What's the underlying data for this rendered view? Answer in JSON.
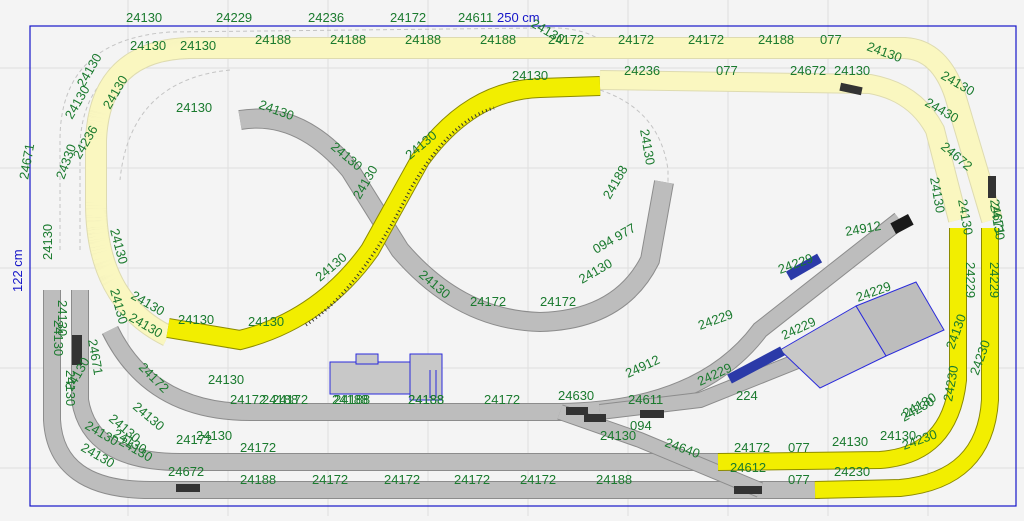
{
  "dimensions": {
    "width_label": "250 cm",
    "height_label": "122 cm"
  },
  "colors": {
    "background": "#f4f4f4",
    "grid": "#dedede",
    "track_grey": "#bdbdbd",
    "track_yellow": "#f2ee00",
    "track_pale_yellow": "#faf7c0",
    "label_green": "#1a7a2e",
    "dimension_blue": "#1515c8",
    "station_blue": "#9aa6d8"
  },
  "labels": [
    {
      "text": "24130"
    },
    {
      "text": "24229"
    },
    {
      "text": "24236"
    },
    {
      "text": "24172"
    },
    {
      "text": "24611"
    },
    {
      "text": "24130"
    },
    {
      "text": "24188"
    },
    {
      "text": "24188"
    },
    {
      "text": "24188"
    },
    {
      "text": "24188"
    },
    {
      "text": "24172"
    },
    {
      "text": "24172"
    },
    {
      "text": "24172"
    },
    {
      "text": "24188"
    },
    {
      "text": "077"
    },
    {
      "text": "24130"
    },
    {
      "text": "24130"
    },
    {
      "text": "24130"
    },
    {
      "text": "24130"
    },
    {
      "text": "24236"
    },
    {
      "text": "24236"
    },
    {
      "text": "077"
    },
    {
      "text": "24672"
    },
    {
      "text": "24130"
    },
    {
      "text": "24130"
    },
    {
      "text": "24130"
    },
    {
      "text": "24130"
    },
    {
      "text": "24430"
    },
    {
      "text": "24130"
    },
    {
      "text": "24130"
    },
    {
      "text": "24130"
    },
    {
      "text": "24130"
    },
    {
      "text": "24130"
    },
    {
      "text": "24672"
    },
    {
      "text": "24671"
    },
    {
      "text": "24130"
    },
    {
      "text": "24330"
    },
    {
      "text": "24130"
    },
    {
      "text": "24130"
    },
    {
      "text": "24188"
    },
    {
      "text": "24130"
    },
    {
      "text": "24130"
    },
    {
      "text": "24130"
    },
    {
      "text": "24130"
    },
    {
      "text": "094 977"
    },
    {
      "text": "24912"
    },
    {
      "text": "24229"
    },
    {
      "text": "24229"
    },
    {
      "text": "24229"
    },
    {
      "text": "24130"
    },
    {
      "text": "24130"
    },
    {
      "text": "24130"
    },
    {
      "text": "24130"
    },
    {
      "text": "24130"
    },
    {
      "text": "24130"
    },
    {
      "text": "24172"
    },
    {
      "text": "24172"
    },
    {
      "text": "24671"
    },
    {
      "text": "24130"
    },
    {
      "text": "24130"
    },
    {
      "text": "24229"
    },
    {
      "text": "24229"
    },
    {
      "text": "24230"
    },
    {
      "text": "24130"
    },
    {
      "text": "24230"
    },
    {
      "text": "24130"
    },
    {
      "text": "24230"
    },
    {
      "text": "24172"
    },
    {
      "text": "24188"
    },
    {
      "text": "24188"
    },
    {
      "text": "24188"
    },
    {
      "text": "24630"
    },
    {
      "text": "24912"
    },
    {
      "text": "24611"
    },
    {
      "text": "24229"
    },
    {
      "text": "224"
    },
    {
      "text": "24229"
    },
    {
      "text": "24130"
    },
    {
      "text": "24130"
    },
    {
      "text": "24130"
    },
    {
      "text": "24172"
    },
    {
      "text": "24188"
    },
    {
      "text": "24188"
    },
    {
      "text": "24172"
    },
    {
      "text": "24172"
    },
    {
      "text": "24172"
    },
    {
      "text": "24640"
    },
    {
      "text": "24172"
    },
    {
      "text": "077"
    },
    {
      "text": "24130"
    },
    {
      "text": "24230"
    },
    {
      "text": "24130"
    },
    {
      "text": "24672"
    },
    {
      "text": "24188"
    },
    {
      "text": "24172"
    },
    {
      "text": "24172"
    },
    {
      "text": "24172"
    },
    {
      "text": "24172"
    },
    {
      "text": "24188"
    },
    {
      "text": "24612"
    },
    {
      "text": "077"
    },
    {
      "text": "24230"
    },
    {
      "text": "24130"
    },
    {
      "text": "24130"
    },
    {
      "text": "24130"
    },
    {
      "text": "24130"
    },
    {
      "text": "24130"
    },
    {
      "text": "24172"
    },
    {
      "text": "24130"
    },
    {
      "text": "24671"
    },
    {
      "text": "094"
    },
    {
      "text": "24130"
    },
    {
      "text": "24130"
    },
    {
      "text": "24130"
    },
    {
      "text": "24130"
    }
  ]
}
